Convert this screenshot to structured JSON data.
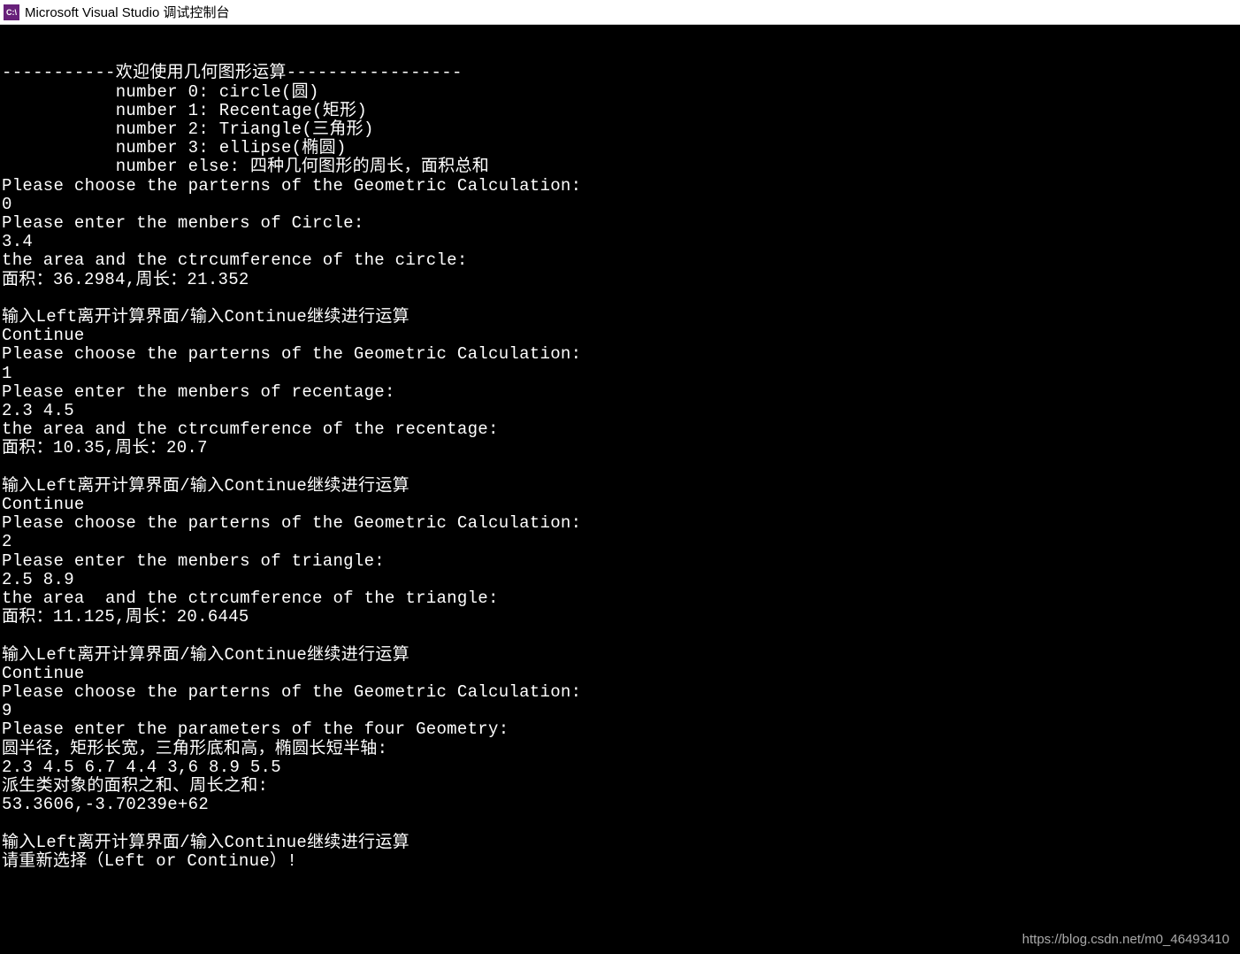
{
  "window": {
    "icon_label": "C:\\",
    "title": "Microsoft Visual Studio 调试控制台"
  },
  "console_lines": [
    "-----------欢迎使用几何图形运算-----------------",
    "           number 0: circle(圆)",
    "           number 1: Recentage(矩形)",
    "           number 2: Triangle(三角形)",
    "           number 3: ellipse(椭圆)",
    "           number else: 四种几何图形的周长，面积总和",
    "Please choose the parterns of the Geometric Calculation:",
    "0",
    "Please enter the menbers of Circle:",
    "3.4",
    "the area and the ctrcumference of the circle:",
    "面积：36.2984,周长：21.352",
    "",
    "输入Left离开计算界面/输入Continue继续进行运算",
    "Continue",
    "Please choose the parterns of the Geometric Calculation:",
    "1",
    "Please enter the menbers of recentage:",
    "2.3 4.5",
    "the area and the ctrcumference of the recentage:",
    "面积：10.35,周长：20.7",
    "",
    "输入Left离开计算界面/输入Continue继续进行运算",
    "Continue",
    "Please choose the parterns of the Geometric Calculation:",
    "2",
    "Please enter the menbers of triangle:",
    "2.5 8.9",
    "the area  and the ctrcumference of the triangle:",
    "面积：11.125,周长：20.6445",
    "",
    "输入Left离开计算界面/输入Continue继续进行运算",
    "Continue",
    "Please choose the parterns of the Geometric Calculation:",
    "9",
    "Please enter the parameters of the four Geometry:",
    "圆半径，矩形长宽，三角形底和高，椭圆长短半轴:",
    "2.3 4.5 6.7 4.4 3,6 8.9 5.5",
    "派生类对象的面积之和、周长之和:",
    "53.3606,-3.70239e+62",
    "",
    "输入Left离开计算界面/输入Continue继续进行运算",
    "请重新选择（Left or Continue）!"
  ],
  "watermark": "https://blog.csdn.net/m0_46493410"
}
